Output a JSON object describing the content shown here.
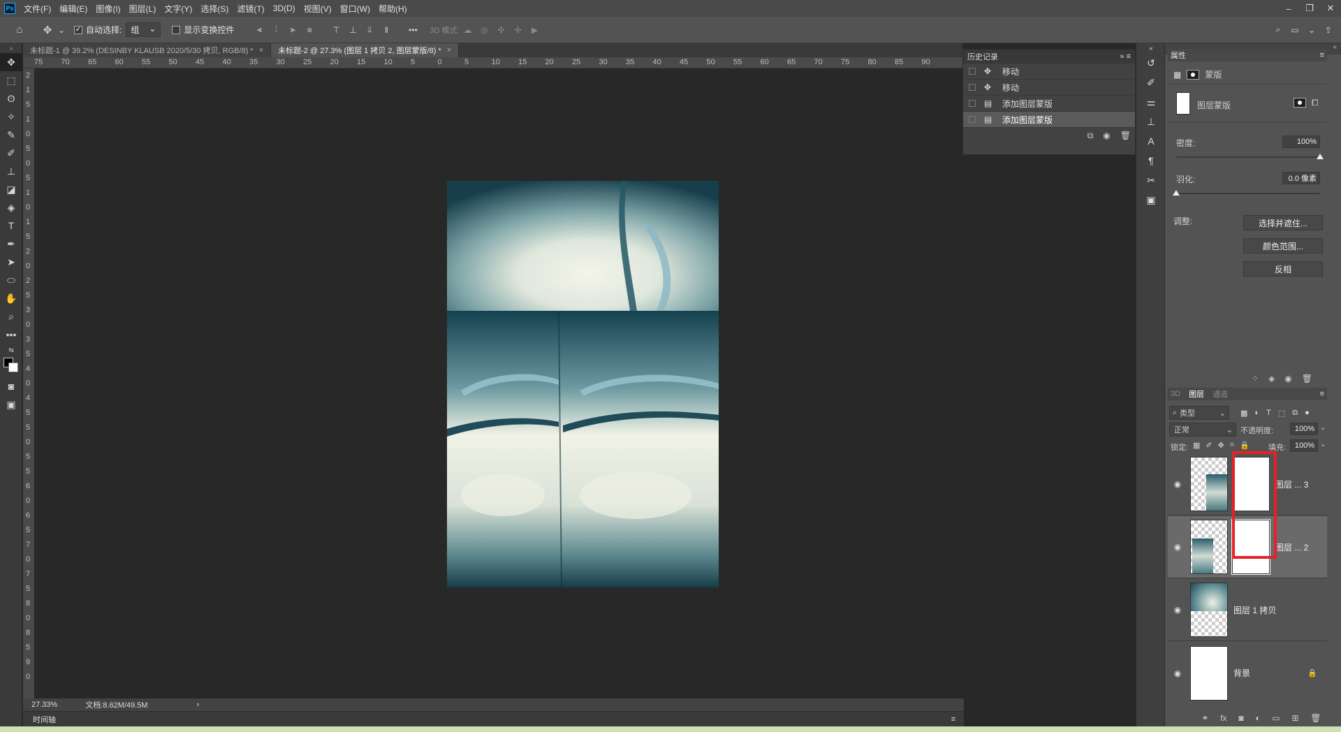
{
  "app": {
    "logo": "Ps"
  },
  "menu": [
    "文件(F)",
    "编辑(E)",
    "图像(I)",
    "图层(L)",
    "文字(Y)",
    "选择(S)",
    "滤镜(T)",
    "3D(D)",
    "视图(V)",
    "窗口(W)",
    "帮助(H)"
  ],
  "options": {
    "auto_select_label": "自动选择:",
    "auto_select_value": "组",
    "show_transform_label": "显示变换控件",
    "mode_3d_label": "3D 模式:"
  },
  "tabs": [
    {
      "label": "未标题-1 @ 39.2% (DESINBY KLAUSB    2020/5/30 拷贝, RGB/8) *"
    },
    {
      "label": "未标题-2 @ 27.3% (图层 1 拷贝 2, 图层蒙版/8) *"
    }
  ],
  "ruler": {
    "h_ticks": [
      "75",
      "70",
      "65",
      "60",
      "55",
      "50",
      "45",
      "40",
      "35",
      "30",
      "25",
      "20",
      "15",
      "10",
      "5",
      "0",
      "5",
      "10",
      "15",
      "20",
      "25",
      "30",
      "35",
      "40",
      "45",
      "50",
      "55",
      "60",
      "65",
      "70",
      "75",
      "80",
      "85",
      "90"
    ],
    "v_ticks": [
      "2",
      "1",
      "5",
      "1",
      "0",
      "5",
      "0",
      "5",
      "1",
      "0",
      "1",
      "5",
      "2",
      "0",
      "2",
      "5",
      "3",
      "0",
      "3",
      "5",
      "4",
      "0",
      "4",
      "5",
      "5",
      "0",
      "5",
      "5",
      "6",
      "0",
      "6",
      "5",
      "7",
      "0",
      "7",
      "5",
      "8",
      "0",
      "8",
      "5",
      "9",
      "0"
    ]
  },
  "status": {
    "zoom": "27.33%",
    "doc": "文档:8.62M/49.5M",
    "arrow": "›"
  },
  "timeline": {
    "label": "时间轴"
  },
  "history": {
    "title": "历史记录",
    "items": [
      {
        "label": "移动",
        "icon": "move-icon"
      },
      {
        "label": "移动",
        "icon": "move-icon"
      },
      {
        "label": "添加图层蒙版",
        "icon": "mask-icon"
      },
      {
        "label": "添加图层蒙版",
        "icon": "mask-icon",
        "selected": true
      }
    ]
  },
  "properties": {
    "title": "属性",
    "mask_label": "蒙版",
    "layer_mask_label": "图层蒙版",
    "density_label": "密度:",
    "density_value": "100%",
    "density_level": 1.0,
    "feather_label": "羽化:",
    "feather_value": "0.0 像素",
    "feather_level": 0.0,
    "adjust_label": "调整:",
    "btn_select_mask": "选择并遮住...",
    "btn_color_range": "颜色范围...",
    "btn_invert": "反相"
  },
  "layers_panel": {
    "tabs": [
      "3D",
      "图层",
      "通道"
    ],
    "filter_label": "类型",
    "blend_mode": "正常",
    "opacity_label": "不透明度:",
    "opacity_value": "100%",
    "lock_label": "锁定:",
    "fill_label": "填充:",
    "fill_value": "100%",
    "layers": [
      {
        "name": "图层 ... 3"
      },
      {
        "name": "图层 ... 2",
        "selected": true
      },
      {
        "name": "图层 1 拷贝"
      },
      {
        "name": "背景"
      }
    ]
  },
  "colors": {
    "highlight": "#e8202a",
    "accent": "#31a8ff"
  }
}
